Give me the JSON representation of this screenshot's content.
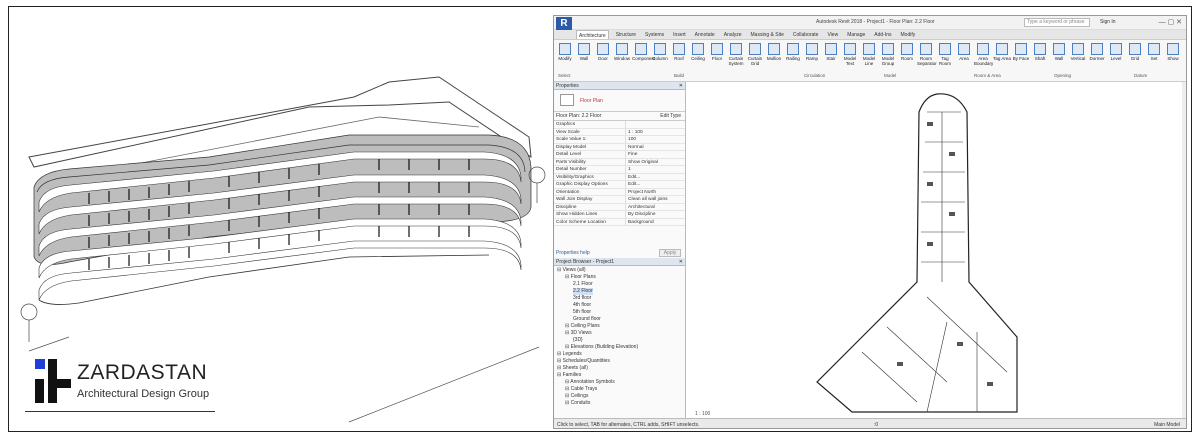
{
  "logo": {
    "name": "ZARDASTAN",
    "tagline": "Architectural Design Group",
    "colors": {
      "blue": "#1f3fd6",
      "black": "#111111"
    }
  },
  "revit": {
    "app_icon": "R",
    "document_title": "Autodesk Revit 2018 - Project1 - Floor Plan: 2.2 Floor",
    "search_placeholder": "Type a keyword or phrase",
    "user": "Sign In",
    "tabs": [
      "Architecture",
      "Structure",
      "Systems",
      "Insert",
      "Annotate",
      "Analyze",
      "Massing & Site",
      "Collaborate",
      "View",
      "Manage",
      "Add-Ins",
      "Modify"
    ],
    "active_tab": "Architecture",
    "ribbon_buttons": [
      "Modify",
      "Wall",
      "Door",
      "Window",
      "Component",
      "Column",
      "Roof",
      "Ceiling",
      "Floor",
      "Curtain System",
      "Curtain Grid",
      "Mullion",
      "Railing",
      "Ramp",
      "Stair",
      "Model Text",
      "Model Line",
      "Model Group",
      "Room",
      "Room Separator",
      "Tag Room",
      "Area",
      "Area Boundary",
      "Tag Area",
      "By Face",
      "Shaft",
      "Wall",
      "Vertical",
      "Dormer",
      "Level",
      "Grid",
      "Set",
      "Show"
    ],
    "ribbon_panels": [
      "Select",
      "Build",
      "Circulation",
      "Model",
      "Room & Area",
      "Opening",
      "Datum"
    ],
    "properties": {
      "title": "Properties",
      "type_name": "Floor Plan",
      "selector": "Floor Plan: 2.2 Floor",
      "edit_type": "Edit Type",
      "rows": [
        {
          "k": "Graphics",
          "v": ""
        },
        {
          "k": "View Scale",
          "v": "1 : 100"
        },
        {
          "k": "Scale Value 1:",
          "v": "100"
        },
        {
          "k": "Display Model",
          "v": "Normal"
        },
        {
          "k": "Detail Level",
          "v": "Fine"
        },
        {
          "k": "Parts Visibility",
          "v": "Show Original"
        },
        {
          "k": "Detail Number",
          "v": "1"
        },
        {
          "k": "Visibility/Graphics",
          "v": "Edit..."
        },
        {
          "k": "Graphic Display Options",
          "v": "Edit..."
        },
        {
          "k": "Orientation",
          "v": "Project North"
        },
        {
          "k": "Wall Join Display",
          "v": "Clean all wall joins"
        },
        {
          "k": "Discipline",
          "v": "Architectural"
        },
        {
          "k": "Show Hidden Lines",
          "v": "By Discipline"
        },
        {
          "k": "Color Scheme Location",
          "v": "Background"
        }
      ],
      "help": "Properties help",
      "apply": "Apply"
    },
    "browser": {
      "title": "Project Browser - Project1",
      "items": [
        {
          "label": "Views (all)",
          "indent": 0
        },
        {
          "label": "Floor Plans",
          "indent": 1
        },
        {
          "label": "2.1 Floor",
          "indent": 2
        },
        {
          "label": "2.2 Floor",
          "indent": 2,
          "selected": true
        },
        {
          "label": "3rd floor",
          "indent": 2
        },
        {
          "label": "4th floor",
          "indent": 2
        },
        {
          "label": "5th floor",
          "indent": 2
        },
        {
          "label": "Ground floor",
          "indent": 2
        },
        {
          "label": "Ceiling Plans",
          "indent": 1
        },
        {
          "label": "3D Views",
          "indent": 1
        },
        {
          "label": "{3D}",
          "indent": 2
        },
        {
          "label": "Elevations (Building Elevation)",
          "indent": 1
        },
        {
          "label": "Legends",
          "indent": 0
        },
        {
          "label": "Schedules/Quantities",
          "indent": 0
        },
        {
          "label": "Sheets (all)",
          "indent": 0
        },
        {
          "label": "Families",
          "indent": 0
        },
        {
          "label": "Annotation Symbols",
          "indent": 1
        },
        {
          "label": "Cable Trays",
          "indent": 1
        },
        {
          "label": "Ceilings",
          "indent": 1
        },
        {
          "label": "Conduits",
          "indent": 1
        }
      ]
    },
    "view_scale": "1 : 100",
    "status_text": "Click to select, TAB for alternates, CTRL adds, SHIFT unselects.",
    "status_zoom": ":0",
    "status_model": "Main Model"
  }
}
